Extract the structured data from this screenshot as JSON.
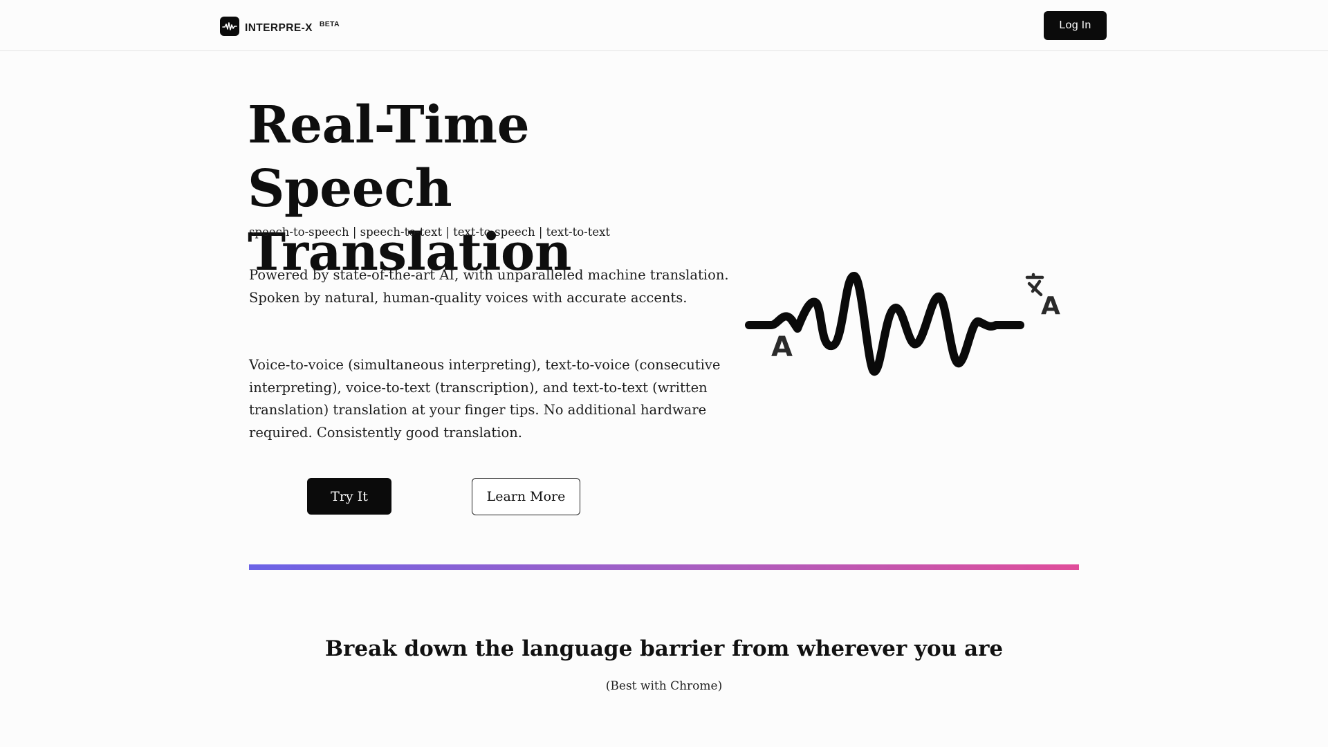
{
  "header": {
    "brand_name": "INTERPRE-X",
    "brand_badge": "BETA",
    "logo_icon": "soundwave-icon",
    "login_label": "Log In"
  },
  "hero": {
    "title": "Real-Time Speech Translation",
    "modes": "speech-to-speech | speech-to-text | text-to-speech | text-to-text",
    "paragraph_1": "Powered by state-of-the-art AI, with unparalleled machine translation. Spoken by natural, human-quality voices with accurate accents.",
    "paragraph_2": "Voice-to-voice (simultaneous interpreting), text-to-voice (consecutive interpreting), voice-to-text (transcription), and text-to-text (written translation) translation at your finger tips. No additional hardware required. Consistently good translation.",
    "try_label": "Try It",
    "learn_label": "Learn More",
    "illustration_icon": "speech-wave-translate-icon",
    "illustration_letters": [
      "A",
      "A"
    ]
  },
  "divider": {
    "gradient_start": "#6b63e6",
    "gradient_end": "#e04d9a"
  },
  "section": {
    "heading": "Break down the language barrier from wherever you are",
    "note": "(Best with Chrome)"
  }
}
